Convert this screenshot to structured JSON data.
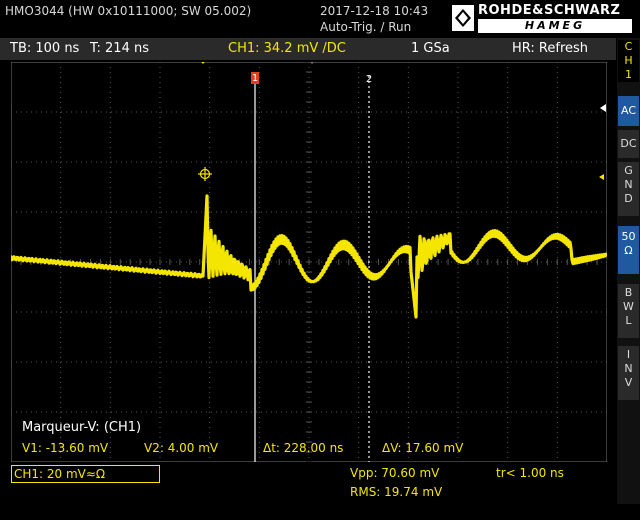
{
  "header": {
    "device": "HMO3044 (HW 0x10111000; SW 05.002)",
    "datetime": "2017-12-18 10:43",
    "trigger_status": "Auto-Trig. / Run",
    "brand_top": "ROHDE&SCHWARZ",
    "brand_bottom": "HAMEG"
  },
  "infobar": {
    "timebase": "TB: 100 ns",
    "time_offset": "T: 214 ns",
    "channel": "CH1: 34.2 mV /DC",
    "sample_rate": "1 GSa",
    "acq_mode": "HR: Refresh"
  },
  "channel_panel": {
    "title_line1": "C",
    "title_line2": "H",
    "title_line3": "1",
    "ac": "AC",
    "dc": "DC",
    "gnd_1": "G",
    "gnd_2": "N",
    "gnd_3": "D",
    "ohm_1": "50",
    "ohm_2": "Ω",
    "bwl_1": "B",
    "bwl_2": "W",
    "bwl_3": "L",
    "inv_1": "I",
    "inv_2": "N",
    "inv_3": "V"
  },
  "plot": {
    "cursor1_label": "1",
    "cursor2_label": "2",
    "ground_marker": "1"
  },
  "cursors": {
    "title": "Marqueur-V: (CH1)",
    "v1": "V1: -13.60 mV",
    "v2": "V2: 4.00 mV",
    "dt": "Δt: 228.00 ns",
    "dv": "ΔV: 17.60 mV"
  },
  "bottom": {
    "ch1_scale": "CH1: 20 mV≈Ω",
    "vpp": "Vpp: 70.60 mV",
    "rms": "RMS: 19.74 mV",
    "rise": "tr< 1.00 ns"
  },
  "colors": {
    "trace": "#f5e600",
    "grid": "#555555",
    "panel_active": "#1f5aa0"
  }
}
